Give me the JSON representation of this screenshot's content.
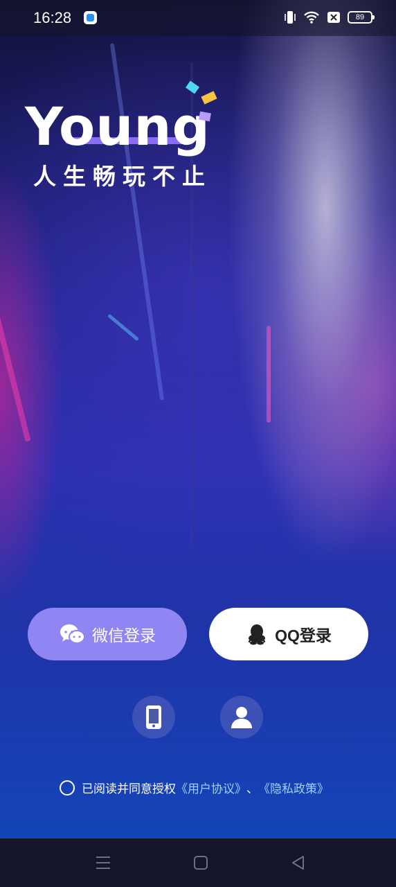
{
  "status_bar": {
    "time": "16:28",
    "battery": "89",
    "icons": [
      "app-icon",
      "vibrate-icon",
      "wifi-icon",
      "no-sim-icon",
      "battery-icon"
    ]
  },
  "logo": {
    "word": "Young",
    "slogan": "人生畅玩不止",
    "accent_color": "#8b6cf7",
    "confetti_colors": [
      "#4fd8f0",
      "#f6c343",
      "#b99cf9"
    ]
  },
  "login": {
    "wechat_label": "微信登录",
    "qq_label": "QQ登录",
    "wechat_color": "#8f86f4",
    "alt_options": [
      "phone-icon",
      "user-icon"
    ]
  },
  "agreement": {
    "prefix": "已阅读并同意授权",
    "user_agreement": "《用户协议》",
    "separator": "、",
    "privacy_policy": "《隐私政策》",
    "link_color": "#9fd3ff"
  },
  "nav_bar": {
    "items": [
      "menu-icon",
      "home-icon",
      "back-icon"
    ]
  }
}
